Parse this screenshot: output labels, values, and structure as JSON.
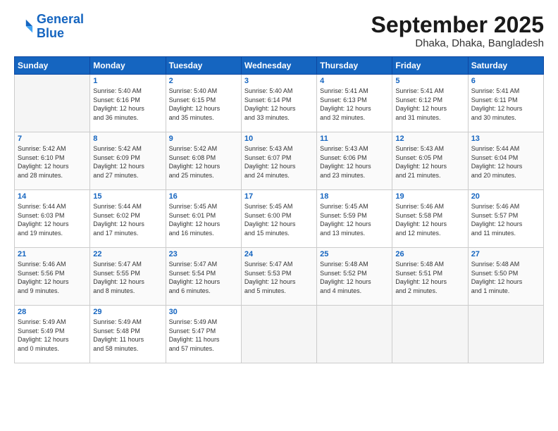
{
  "logo": {
    "line1": "General",
    "line2": "Blue"
  },
  "header": {
    "month": "September 2025",
    "location": "Dhaka, Dhaka, Bangladesh"
  },
  "days_of_week": [
    "Sunday",
    "Monday",
    "Tuesday",
    "Wednesday",
    "Thursday",
    "Friday",
    "Saturday"
  ],
  "weeks": [
    [
      {
        "day": "",
        "content": ""
      },
      {
        "day": "1",
        "content": "Sunrise: 5:40 AM\nSunset: 6:16 PM\nDaylight: 12 hours\nand 36 minutes."
      },
      {
        "day": "2",
        "content": "Sunrise: 5:40 AM\nSunset: 6:15 PM\nDaylight: 12 hours\nand 35 minutes."
      },
      {
        "day": "3",
        "content": "Sunrise: 5:40 AM\nSunset: 6:14 PM\nDaylight: 12 hours\nand 33 minutes."
      },
      {
        "day": "4",
        "content": "Sunrise: 5:41 AM\nSunset: 6:13 PM\nDaylight: 12 hours\nand 32 minutes."
      },
      {
        "day": "5",
        "content": "Sunrise: 5:41 AM\nSunset: 6:12 PM\nDaylight: 12 hours\nand 31 minutes."
      },
      {
        "day": "6",
        "content": "Sunrise: 5:41 AM\nSunset: 6:11 PM\nDaylight: 12 hours\nand 30 minutes."
      }
    ],
    [
      {
        "day": "7",
        "content": "Sunrise: 5:42 AM\nSunset: 6:10 PM\nDaylight: 12 hours\nand 28 minutes."
      },
      {
        "day": "8",
        "content": "Sunrise: 5:42 AM\nSunset: 6:09 PM\nDaylight: 12 hours\nand 27 minutes."
      },
      {
        "day": "9",
        "content": "Sunrise: 5:42 AM\nSunset: 6:08 PM\nDaylight: 12 hours\nand 25 minutes."
      },
      {
        "day": "10",
        "content": "Sunrise: 5:43 AM\nSunset: 6:07 PM\nDaylight: 12 hours\nand 24 minutes."
      },
      {
        "day": "11",
        "content": "Sunrise: 5:43 AM\nSunset: 6:06 PM\nDaylight: 12 hours\nand 23 minutes."
      },
      {
        "day": "12",
        "content": "Sunrise: 5:43 AM\nSunset: 6:05 PM\nDaylight: 12 hours\nand 21 minutes."
      },
      {
        "day": "13",
        "content": "Sunrise: 5:44 AM\nSunset: 6:04 PM\nDaylight: 12 hours\nand 20 minutes."
      }
    ],
    [
      {
        "day": "14",
        "content": "Sunrise: 5:44 AM\nSunset: 6:03 PM\nDaylight: 12 hours\nand 19 minutes."
      },
      {
        "day": "15",
        "content": "Sunrise: 5:44 AM\nSunset: 6:02 PM\nDaylight: 12 hours\nand 17 minutes."
      },
      {
        "day": "16",
        "content": "Sunrise: 5:45 AM\nSunset: 6:01 PM\nDaylight: 12 hours\nand 16 minutes."
      },
      {
        "day": "17",
        "content": "Sunrise: 5:45 AM\nSunset: 6:00 PM\nDaylight: 12 hours\nand 15 minutes."
      },
      {
        "day": "18",
        "content": "Sunrise: 5:45 AM\nSunset: 5:59 PM\nDaylight: 12 hours\nand 13 minutes."
      },
      {
        "day": "19",
        "content": "Sunrise: 5:46 AM\nSunset: 5:58 PM\nDaylight: 12 hours\nand 12 minutes."
      },
      {
        "day": "20",
        "content": "Sunrise: 5:46 AM\nSunset: 5:57 PM\nDaylight: 12 hours\nand 11 minutes."
      }
    ],
    [
      {
        "day": "21",
        "content": "Sunrise: 5:46 AM\nSunset: 5:56 PM\nDaylight: 12 hours\nand 9 minutes."
      },
      {
        "day": "22",
        "content": "Sunrise: 5:47 AM\nSunset: 5:55 PM\nDaylight: 12 hours\nand 8 minutes."
      },
      {
        "day": "23",
        "content": "Sunrise: 5:47 AM\nSunset: 5:54 PM\nDaylight: 12 hours\nand 6 minutes."
      },
      {
        "day": "24",
        "content": "Sunrise: 5:47 AM\nSunset: 5:53 PM\nDaylight: 12 hours\nand 5 minutes."
      },
      {
        "day": "25",
        "content": "Sunrise: 5:48 AM\nSunset: 5:52 PM\nDaylight: 12 hours\nand 4 minutes."
      },
      {
        "day": "26",
        "content": "Sunrise: 5:48 AM\nSunset: 5:51 PM\nDaylight: 12 hours\nand 2 minutes."
      },
      {
        "day": "27",
        "content": "Sunrise: 5:48 AM\nSunset: 5:50 PM\nDaylight: 12 hours\nand 1 minute."
      }
    ],
    [
      {
        "day": "28",
        "content": "Sunrise: 5:49 AM\nSunset: 5:49 PM\nDaylight: 12 hours\nand 0 minutes."
      },
      {
        "day": "29",
        "content": "Sunrise: 5:49 AM\nSunset: 5:48 PM\nDaylight: 11 hours\nand 58 minutes."
      },
      {
        "day": "30",
        "content": "Sunrise: 5:49 AM\nSunset: 5:47 PM\nDaylight: 11 hours\nand 57 minutes."
      },
      {
        "day": "",
        "content": ""
      },
      {
        "day": "",
        "content": ""
      },
      {
        "day": "",
        "content": ""
      },
      {
        "day": "",
        "content": ""
      }
    ]
  ]
}
